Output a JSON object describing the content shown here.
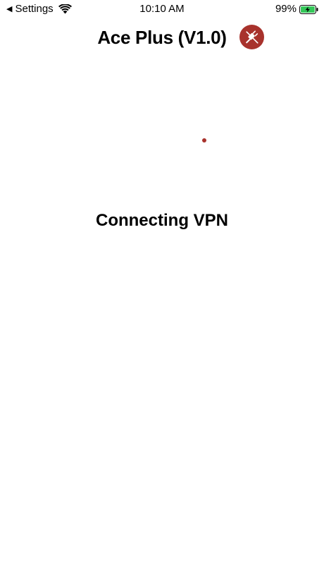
{
  "status_bar": {
    "back_arrow": "◀",
    "back_label": "Settings",
    "time": "10:10 AM",
    "battery_percent": "99%",
    "battery_level": 0.99,
    "battery_color": "#34c759"
  },
  "header": {
    "title": "Ace Plus (V1.0)",
    "disconnect_icon": "unplug-icon",
    "accent_color": "#a8322c"
  },
  "main": {
    "spinner_icon": "loading-dot",
    "status_message": "Connecting VPN"
  }
}
